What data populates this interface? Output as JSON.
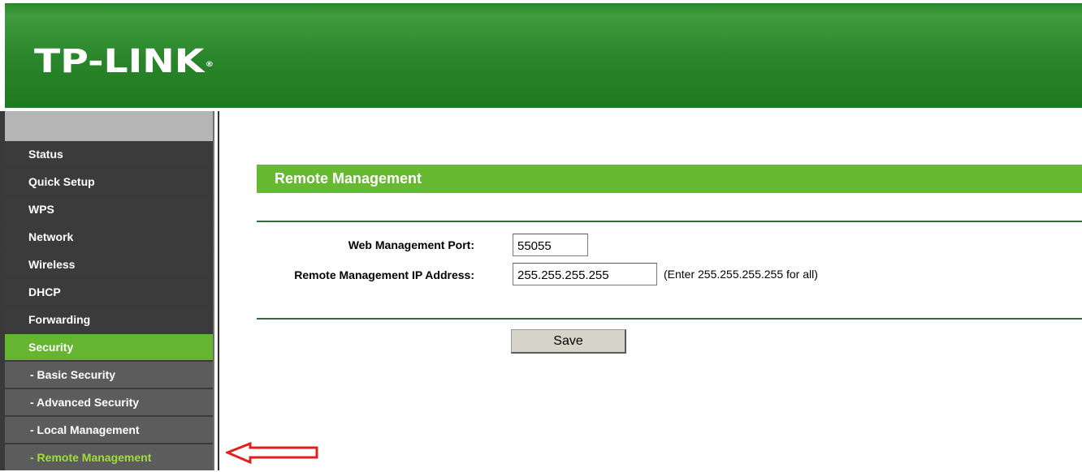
{
  "header": {
    "logo": "TP-LINK",
    "logo_mark": "®"
  },
  "sidebar": {
    "items": [
      {
        "label": "Status"
      },
      {
        "label": "Quick Setup"
      },
      {
        "label": "WPS"
      },
      {
        "label": "Network"
      },
      {
        "label": "Wireless"
      },
      {
        "label": "DHCP"
      },
      {
        "label": "Forwarding"
      },
      {
        "label": "Security",
        "state": "active"
      },
      {
        "label": "- Basic Security"
      },
      {
        "label": "- Advanced Security"
      },
      {
        "label": "- Local Management"
      },
      {
        "label": "- Remote Management",
        "state": "selected"
      }
    ]
  },
  "main": {
    "title": "Remote Management",
    "fields": {
      "port_label": "Web Management Port:",
      "port_value": "55055",
      "ip_label": "Remote Management IP Address:",
      "ip_value": "255.255.255.255",
      "ip_hint": "(Enter 255.255.255.255 for all)"
    },
    "save_label": "Save"
  },
  "annotation": {
    "icon": "arrow-left-icon",
    "color": "#e0201e"
  },
  "colors": {
    "accent_green": "#66b931",
    "header_green": "#2a852a",
    "menu_bg": "#3b3b3b"
  }
}
